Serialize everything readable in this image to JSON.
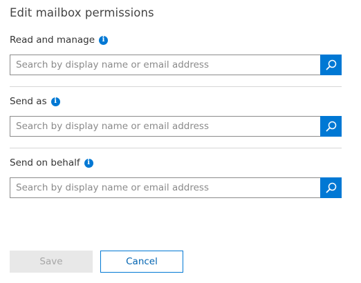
{
  "panel": {
    "title": "Edit mailbox permissions"
  },
  "sections": [
    {
      "label": "Read and manage",
      "placeholder": "Search by display name or email address"
    },
    {
      "label": "Send as",
      "placeholder": "Search by display name or email address"
    },
    {
      "label": "Send on behalf",
      "placeholder": "Search by display name or email address"
    }
  ],
  "icons": {
    "info": "info-icon",
    "search": "search-icon"
  },
  "colors": {
    "accent": "#0078d4",
    "disabled_bg": "#e8e8e8",
    "disabled_text": "#a6a6a6"
  },
  "footer": {
    "save_label": "Save",
    "cancel_label": "Cancel"
  }
}
